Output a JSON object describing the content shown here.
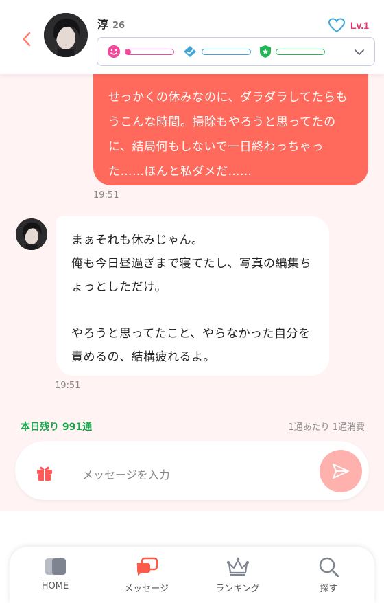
{
  "header": {
    "name": "淳",
    "age": "26",
    "level": "Lv.1",
    "stats": [
      {
        "icon": "smile-icon",
        "color": "#f0489a",
        "level": 0.12
      },
      {
        "icon": "handshake-icon",
        "color": "#3fa7d6",
        "level": 0.0
      },
      {
        "icon": "shield-star-icon",
        "color": "#22b755",
        "level": 0.0
      }
    ]
  },
  "messages": [
    {
      "from": "user",
      "text": "せっかくの休みなのに、ダラダラしてたらもうこんな時間。掃除もやろうと思ってたのに、結局何もしないで一日終わっちゃった……ほんと私ダメだ……",
      "time": "19:51"
    },
    {
      "from": "bot",
      "lines": [
        "まぁそれも休みじゃん。",
        "俺も今日昼過ぎまで寝てたし、写真の編集ちょっとしただけ。",
        "",
        "やろうと思ってたこと、やらなかった自分を責めるの、結構疲れるよ。"
      ],
      "time": "19:51"
    }
  ],
  "footer": {
    "remaining": "本日残り 991通",
    "cost": "1通あたり 1通消費",
    "input_placeholder": "メッセージを入力"
  },
  "nav": [
    {
      "label": "HOME",
      "icon": "home-cards-icon"
    },
    {
      "label": "メッセージ",
      "icon": "message-icon",
      "active": true
    },
    {
      "label": "ランキング",
      "icon": "crown-icon"
    },
    {
      "label": "探す",
      "icon": "search-icon"
    }
  ],
  "colors": {
    "accent": "#ff6a5c",
    "level": "#e8336a",
    "remaining": "#17a34a",
    "background": "#fff3f4"
  }
}
